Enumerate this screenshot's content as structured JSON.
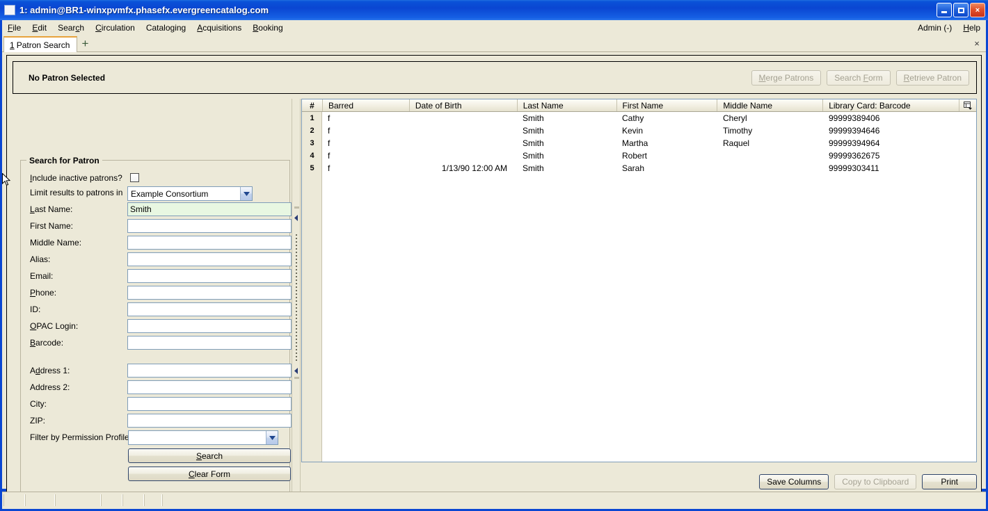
{
  "window": {
    "title": "1: admin@BR1-winxpvmfx.phasefx.evergreencatalog.com",
    "minimize_label": "Minimize",
    "maximize_label": "Maximize",
    "close_label": "×",
    "title_bar_color": "#0a46d2"
  },
  "menubar": {
    "items": [
      {
        "label": "File",
        "accel": "F"
      },
      {
        "label": "Edit",
        "accel": "E"
      },
      {
        "label": "Search",
        "accel": "c"
      },
      {
        "label": "Circulation",
        "accel": "C"
      },
      {
        "label": "Cataloging",
        "accel": "g"
      },
      {
        "label": "Acquisitions",
        "accel": "A"
      },
      {
        "label": "Booking",
        "accel": "B"
      }
    ],
    "right_items": [
      {
        "label": "Admin (-)"
      },
      {
        "label": "Help"
      }
    ]
  },
  "tabs": {
    "items": [
      {
        "number": "1",
        "label": "Patron Search",
        "active": true
      }
    ],
    "add_label": "+",
    "close_label": "×"
  },
  "patron_header": {
    "title": "No Patron Selected",
    "buttons": [
      {
        "label": "Merge Patrons",
        "enabled": false
      },
      {
        "label": "Search Form",
        "enabled": false
      },
      {
        "label": "Retrieve Patron",
        "enabled": false
      }
    ]
  },
  "search_form": {
    "legend": "Search for Patron",
    "include_inactive_label": "Include inactive patrons?",
    "include_inactive_checked": false,
    "limit_results_label": "Limit results to patrons in",
    "limit_results_value": "Example Consortium",
    "fields": [
      {
        "label": "Last Name:",
        "value": "Smith",
        "focused": true,
        "placeholder": ""
      },
      {
        "label": "First Name:",
        "value": "",
        "focused": false,
        "placeholder": ""
      },
      {
        "label": "Middle Name:",
        "value": "",
        "focused": false,
        "placeholder": ""
      },
      {
        "label": "Alias:",
        "value": "",
        "focused": false,
        "placeholder": ""
      },
      {
        "label": "Email:",
        "value": "",
        "focused": false,
        "placeholder": ""
      },
      {
        "label": "Phone:",
        "value": "",
        "focused": false,
        "placeholder": ""
      },
      {
        "label": "ID:",
        "value": "",
        "focused": false,
        "placeholder": ""
      },
      {
        "label": "OPAC Login:",
        "value": "",
        "focused": false,
        "placeholder": ""
      },
      {
        "label": "Barcode:",
        "value": "",
        "focused": false,
        "placeholder": ""
      },
      {
        "label": "Address 1:",
        "value": "",
        "focused": false,
        "placeholder": ""
      },
      {
        "label": "Address 2:",
        "value": "",
        "focused": false,
        "placeholder": ""
      },
      {
        "label": "City:",
        "value": "",
        "focused": false,
        "placeholder": ""
      },
      {
        "label": "ZIP:",
        "value": "",
        "focused": false,
        "placeholder": ""
      }
    ],
    "permission_profile_label": "Filter by Permission Profile:",
    "permission_profile_value": "",
    "search_button": "Search",
    "clear_button": "Clear Form"
  },
  "results": {
    "columns": [
      {
        "label": "#",
        "width": 29
      },
      {
        "label": "Barred",
        "width": 125
      },
      {
        "label": "Date of Birth",
        "width": 155
      },
      {
        "label": "Last Name",
        "width": 143
      },
      {
        "label": "First Name",
        "width": 145
      },
      {
        "label": "Middle Name",
        "width": 152
      },
      {
        "label": "Library Card: Barcode",
        "width": 196
      }
    ],
    "rows": [
      {
        "num": "1",
        "barred": "f",
        "dob": "",
        "last": "Smith",
        "first": "Cathy",
        "middle": "Cheryl",
        "barcode": "99999389406"
      },
      {
        "num": "2",
        "barred": "f",
        "dob": "",
        "last": "Smith",
        "first": "Kevin",
        "middle": "Timothy",
        "barcode": "99999394646"
      },
      {
        "num": "3",
        "barred": "f",
        "dob": "",
        "last": "Smith",
        "first": "Martha",
        "middle": "Raquel",
        "barcode": "99999394964"
      },
      {
        "num": "4",
        "barred": "f",
        "dob": "",
        "last": "Smith",
        "first": "Robert",
        "middle": "",
        "barcode": "99999362675"
      },
      {
        "num": "5",
        "barred": "f",
        "dob": "1/13/90 12:00 AM",
        "last": "Smith",
        "first": "Sarah",
        "middle": "",
        "barcode": "99999303411"
      }
    ],
    "column_picker_tooltip": "Column Picker",
    "footer_buttons": [
      {
        "label": "Save Columns",
        "enabled": true
      },
      {
        "label": "Copy to Clipboard",
        "enabled": false
      },
      {
        "label": "Print",
        "enabled": true
      }
    ]
  },
  "statusbar": {
    "panels": [
      "",
      "",
      "",
      "",
      "",
      "",
      ""
    ]
  }
}
